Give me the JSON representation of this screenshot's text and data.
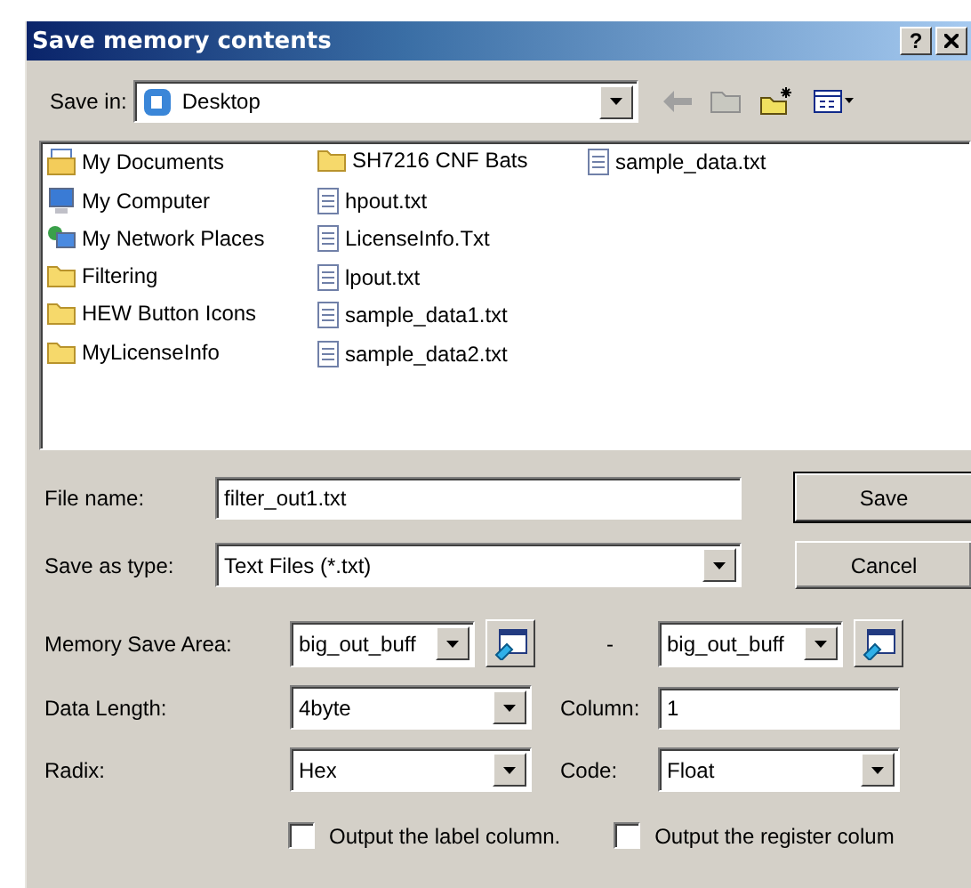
{
  "window": {
    "title": "Save memory contents",
    "help_button": "?"
  },
  "save_in": {
    "label": "Save in:",
    "value": "Desktop"
  },
  "files": [
    {
      "name": "My Documents",
      "kind": "documents"
    },
    {
      "name": "My Computer",
      "kind": "computer"
    },
    {
      "name": "My Network Places",
      "kind": "network"
    },
    {
      "name": "Filtering",
      "kind": "folder"
    },
    {
      "name": "HEW Button Icons",
      "kind": "folder"
    },
    {
      "name": "MyLicenseInfo",
      "kind": "folder"
    },
    {
      "name": "SH7216 CNF Bats",
      "kind": "folder"
    },
    {
      "name": "hpout.txt",
      "kind": "text"
    },
    {
      "name": "LicenseInfo.Txt",
      "kind": "text"
    },
    {
      "name": "lpout.txt",
      "kind": "text"
    },
    {
      "name": "sample_data1.txt",
      "kind": "text"
    },
    {
      "name": "sample_data2.txt",
      "kind": "text"
    },
    {
      "name": "sample_data.txt",
      "kind": "text"
    }
  ],
  "file_name": {
    "label": "File name:",
    "value": "filter_out1.txt"
  },
  "save_as_type": {
    "label": "Save as type:",
    "value": "Text Files (*.txt)"
  },
  "buttons": [
    "Save",
    "Cancel"
  ],
  "memory_save_area": {
    "label": "Memory Save Area:",
    "start": "big_out_buff",
    "separator": "-",
    "end": "big_out_buff"
  },
  "data_length": {
    "label": "Data Length:",
    "value": "4byte"
  },
  "column": {
    "label": "Column:",
    "value": "1"
  },
  "radix": {
    "label": "Radix:",
    "value": "Hex"
  },
  "code": {
    "label": "Code:",
    "value": "Float"
  },
  "options": [
    {
      "label": "Output the label column.",
      "checked": false
    },
    {
      "label": "Output the register colum",
      "checked": false
    }
  ]
}
